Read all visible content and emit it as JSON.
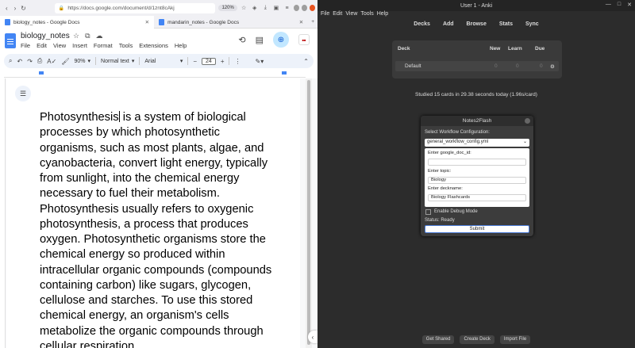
{
  "browser": {
    "url": "https://docs.google.com/document/d/1znt8cAkj",
    "zoom": "120%",
    "tabs": [
      {
        "label": "biology_notes - Google Docs",
        "active": true
      },
      {
        "label": "mandarin_notes - Google Docs",
        "active": false
      }
    ]
  },
  "docs": {
    "title": "biology_notes",
    "menu": [
      "File",
      "Edit",
      "View",
      "Insert",
      "Format",
      "Tools",
      "Extensions",
      "Help"
    ],
    "toolbar": {
      "zoom": "90%",
      "style": "Normal text",
      "font": "Arial",
      "font_size": "24"
    },
    "body_first_word": "Photosynthesis",
    "body_rest": " is a system of biological processes by which photosynthetic organisms, such as most plants, algae, and cyanobacteria, convert light energy, typically from sunlight, into the chemical energy necessary to fuel their metabolism. Photosynthesis usually refers to oxygenic photosynthesis, a process that produces oxygen. Photosynthetic organisms store the chemical energy so produced within intracellular organic compounds (compounds containing carbon) like sugars, glycogen, cellulose and starches. To use this stored chemical energy, an organism's cells metabolize the organic compounds through cellular respiration."
  },
  "anki": {
    "window_title": "User 1 - Anki",
    "menu": [
      "File",
      "Edit",
      "View",
      "Tools",
      "Help"
    ],
    "toolbar": [
      "Decks",
      "Add",
      "Browse",
      "Stats",
      "Sync"
    ],
    "deck_headers": {
      "deck": "Deck",
      "new": "New",
      "learn": "Learn",
      "due": "Due"
    },
    "decks": [
      {
        "name": "Default",
        "new": "0",
        "learn": "0",
        "due": "0"
      }
    ],
    "studied": "Studied 15 cards in 29.38 seconds today (1.96s/card)",
    "bottom_buttons": [
      "Get Shared",
      "Create Deck",
      "Import File"
    ]
  },
  "dialog": {
    "title": "Notes2Flash",
    "workflow_label": "Select Workflow Configuration:",
    "workflow_value": "general_workflow_config.yml",
    "doc_id_label": "Enter google_doc_id:",
    "doc_id_value": "",
    "topic_label": "Enter topic:",
    "topic_value": "Biology",
    "deckname_label": "Enter deckname:",
    "deckname_value": "Biology Flashcards",
    "debug_label": "Enable Debug Mode",
    "status": "Status: Ready",
    "submit": "Submit"
  }
}
